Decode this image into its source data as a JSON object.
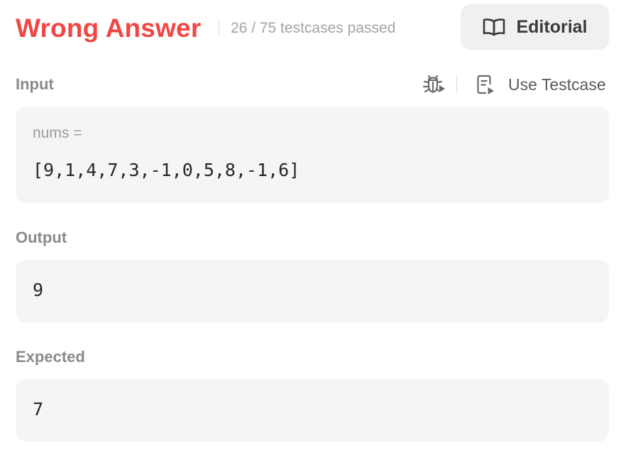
{
  "result": {
    "status": "Wrong Answer",
    "testcases_passed": "26 / 75 testcases passed",
    "editorial_label": "Editorial"
  },
  "input": {
    "label": "Input",
    "use_testcase_label": "Use Testcase",
    "param_name": "nums =",
    "param_value": "[9,1,4,7,3,-1,0,5,8,-1,6]"
  },
  "output": {
    "label": "Output",
    "value": "9"
  },
  "expected": {
    "label": "Expected",
    "value": "7"
  },
  "icons": {
    "editorial": "open-book-icon",
    "debug": "bug-play-icon",
    "use_testcase": "document-play-icon"
  },
  "colors": {
    "status": "#ef4743",
    "muted": "#a3a3a3",
    "box_background": "#f5f5f5",
    "button_background": "#f0f0f0"
  }
}
